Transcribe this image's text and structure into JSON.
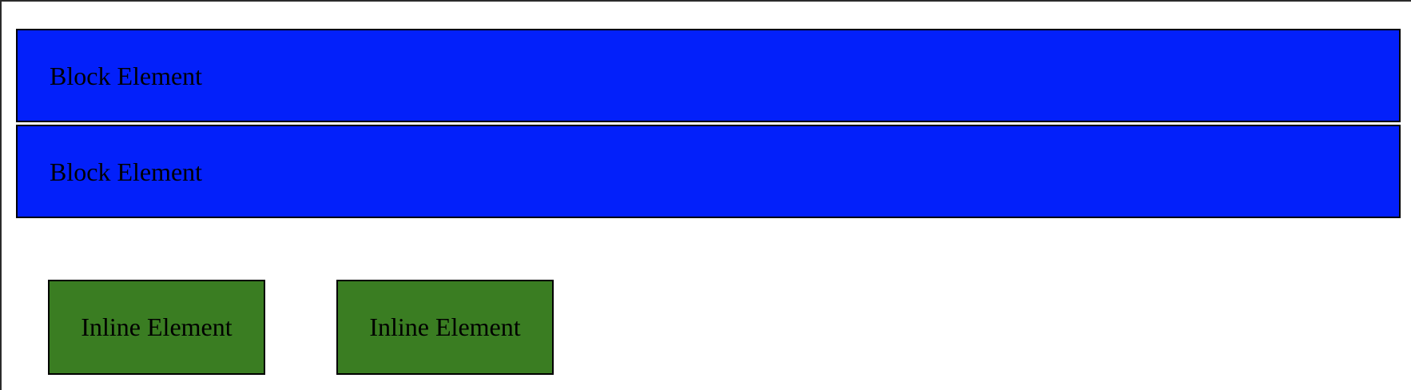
{
  "colors": {
    "block_background": "#0320FA",
    "inline_background": "#3A7D22",
    "border": "#000000",
    "frame_border": "#2b2b2b"
  },
  "blocks": [
    {
      "label": "Block Element"
    },
    {
      "label": "Block Element"
    }
  ],
  "inlines": [
    {
      "label": "Inline Element"
    },
    {
      "label": "Inline Element"
    }
  ]
}
